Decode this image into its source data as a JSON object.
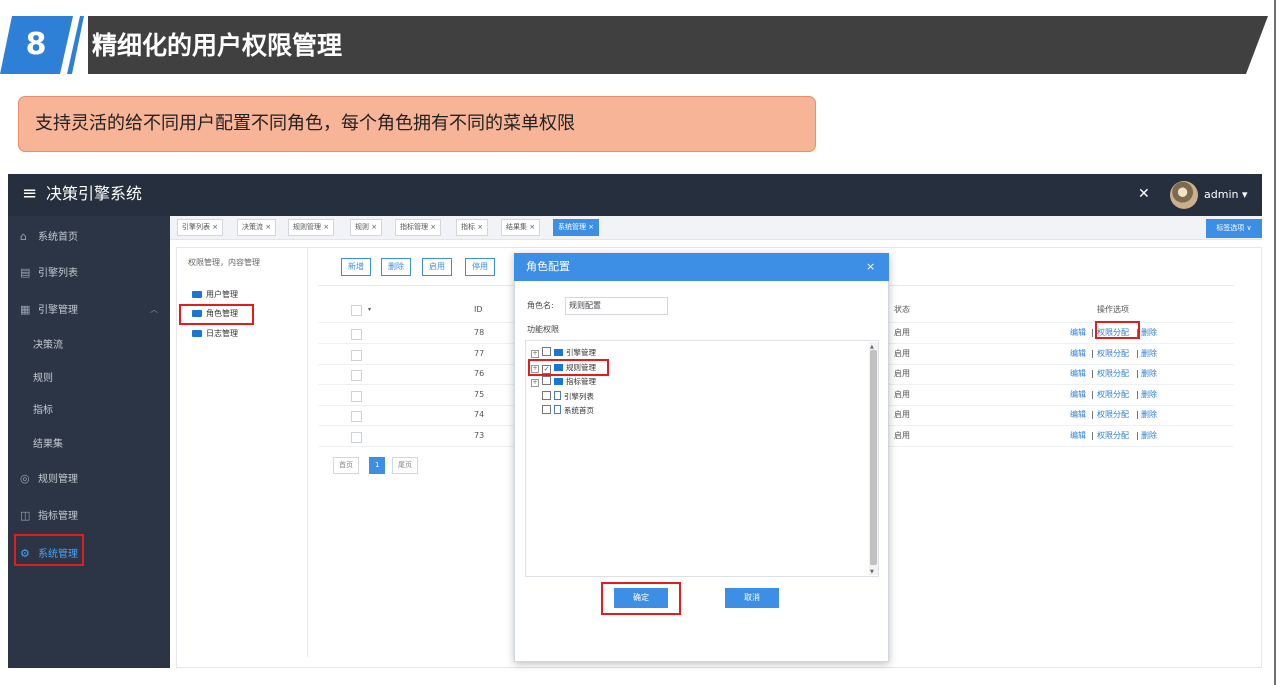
{
  "slide": {
    "number": "8",
    "title": "精细化的用户权限管理",
    "callout": "支持灵活的给不同用户配置不同角色，每个角色拥有不同的菜单权限"
  },
  "app": {
    "menu_icon": "≡",
    "title": "决策引擎系统",
    "fullscreen_icon": "✕",
    "user": "admin ▾"
  },
  "sidebar": {
    "items": [
      {
        "icon": "⌂",
        "label": "系统首页"
      },
      {
        "icon": "▤",
        "label": "引擎列表"
      },
      {
        "icon": "▦",
        "label": "引擎管理",
        "chevron": "︿"
      },
      {
        "label": "决策流"
      },
      {
        "label": "规则"
      },
      {
        "label": "指标"
      },
      {
        "label": "结果集"
      },
      {
        "icon": "◎",
        "label": "规则管理"
      },
      {
        "icon": "◫",
        "label": "指标管理"
      },
      {
        "icon": "⚙",
        "label": "系统管理"
      }
    ]
  },
  "tabs": [
    {
      "label": "引擎列表 ×"
    },
    {
      "label": "决策流 ×"
    },
    {
      "label": "规则管理 ×"
    },
    {
      "label": "规则 ×"
    },
    {
      "label": "指标管理 ×"
    },
    {
      "label": "指标 ×"
    },
    {
      "label": "结果集 ×"
    },
    {
      "label": "系统管理 ×"
    }
  ],
  "tab_options": "标签选项 ∨",
  "left_tree": {
    "breadcrumb": "权限管理，内容管理",
    "items": [
      "用户管理",
      "角色管理",
      "日志管理"
    ]
  },
  "toolbar": {
    "add": "新增",
    "delete": "删除",
    "enable": "启用",
    "disable": "停用"
  },
  "table": {
    "col_id": "ID",
    "col_status": "状态",
    "col_ops": "操作选项",
    "sort_icon": "▾",
    "rows": [
      {
        "id": "78",
        "status": "启用"
      },
      {
        "id": "77",
        "status": "启用"
      },
      {
        "id": "76",
        "status": "启用"
      },
      {
        "id": "75",
        "status": "启用"
      },
      {
        "id": "74",
        "status": "启用"
      },
      {
        "id": "73",
        "status": "启用"
      }
    ],
    "op_edit": "编辑",
    "op_sep": "|",
    "op_perm": "权限分配",
    "op_del": "删除"
  },
  "pagination": {
    "first": "首页",
    "current": "1",
    "last": "尾页"
  },
  "modal": {
    "title": "角色配置",
    "close": "×",
    "role_name_label": "角色名:",
    "role_name_value": "规则配置",
    "perm_label": "功能权限",
    "scroll_up": "▲",
    "scroll_down": "▼",
    "tree": [
      {
        "expand": "+",
        "checked": "",
        "type": "folder",
        "label": "引擎管理"
      },
      {
        "expand": "+",
        "checked": "✓",
        "type": "folder",
        "label": "规则管理"
      },
      {
        "expand": "+",
        "checked": "",
        "type": "folder",
        "label": "指标管理"
      },
      {
        "expand": "",
        "checked": "",
        "type": "file",
        "label": "引擎列表"
      },
      {
        "expand": "",
        "checked": "",
        "type": "file",
        "label": "系统首页"
      }
    ],
    "ok": "确定",
    "cancel": "取消"
  }
}
